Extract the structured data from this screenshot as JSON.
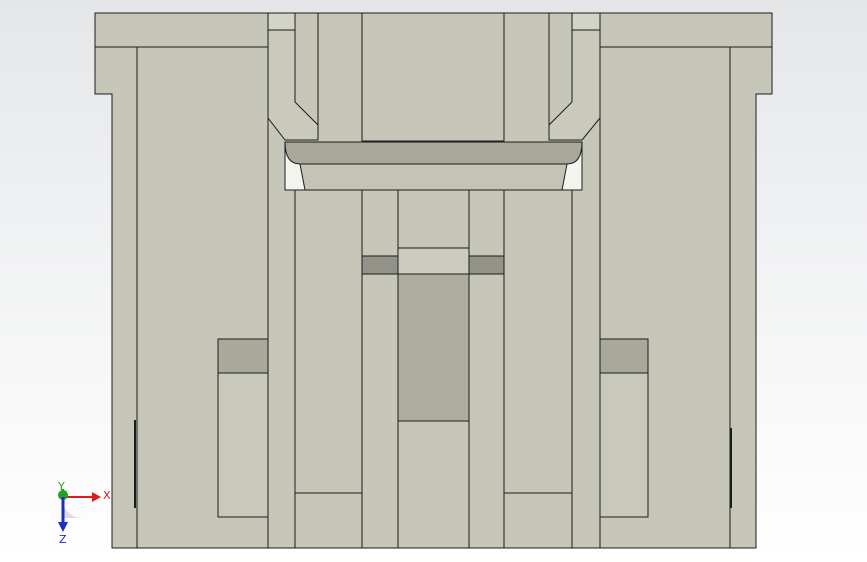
{
  "app": {
    "view": "front"
  },
  "colors": {
    "background_top": "#e4e6e8",
    "background_bottom": "#ffffff",
    "part_face": "#c6c6b9",
    "part_face_light": "#cbcbbf",
    "part_face_dark": "#a9a99b",
    "slot_dark": "#929288",
    "edge": "#1c1c1c",
    "axis_x": "#e01b1b",
    "axis_y": "#1ea51e",
    "axis_z": "#1a2bd4"
  },
  "triad": {
    "x_label": "X",
    "y_label": "Y",
    "z_label": "Z",
    "x_icon": "arrow-right-icon",
    "y_icon": "arrow-up-icon",
    "z_icon": "arrow-down-icon"
  }
}
